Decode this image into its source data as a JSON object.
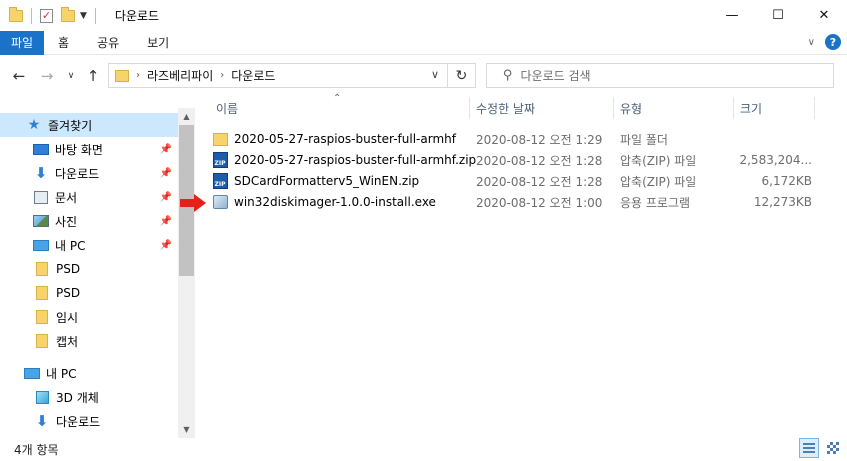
{
  "window": {
    "title": "다운로드",
    "minimize_glyph": "—",
    "maximize_glyph": "☐",
    "close_glyph": "✕"
  },
  "ribbon": {
    "tabs": [
      "파일",
      "홈",
      "공유",
      "보기"
    ],
    "help_label": "?"
  },
  "navigation": {
    "breadcrumb": [
      "라즈베리파이",
      "다운로드"
    ],
    "search_placeholder": "다운로드 검색"
  },
  "sidebar": {
    "items": [
      {
        "label": "즐겨찾기",
        "icon": "star-icon",
        "pinned": false,
        "selected": true
      },
      {
        "label": "바탕 화면",
        "icon": "desktop-icon",
        "pinned": true
      },
      {
        "label": "다운로드",
        "icon": "download-icon",
        "pinned": true
      },
      {
        "label": "문서",
        "icon": "document-icon",
        "pinned": true
      },
      {
        "label": "사진",
        "icon": "picture-icon",
        "pinned": true
      },
      {
        "label": "내 PC",
        "icon": "pc-icon",
        "pinned": true
      },
      {
        "label": "PSD",
        "icon": "folder-icon",
        "pinned": false
      },
      {
        "label": "PSD",
        "icon": "folder-icon",
        "pinned": false
      },
      {
        "label": "임시",
        "icon": "folder-icon",
        "pinned": false
      },
      {
        "label": "캡처",
        "icon": "folder-icon",
        "pinned": false
      },
      {
        "label": "내 PC",
        "icon": "pc-icon",
        "pinned": false
      },
      {
        "label": "3D 개체",
        "icon": "3d-objects-icon",
        "pinned": false
      },
      {
        "label": "다운로드",
        "icon": "download-icon",
        "pinned": false
      }
    ]
  },
  "file_list": {
    "columns": {
      "name": "이름",
      "modified": "수정한 날짜",
      "type": "유형",
      "size": "크기"
    },
    "rows": [
      {
        "name": "2020-05-27-raspios-buster-full-armhf",
        "modified": "2020-08-12 오전 1:29",
        "type": "파일 폴더",
        "size": "",
        "icon": "folder-icon"
      },
      {
        "name": "2020-05-27-raspios-buster-full-armhf.zip",
        "modified": "2020-08-12 오전 1:28",
        "type": "압축(ZIP) 파일",
        "size": "2,583,204...",
        "icon": "zip-icon"
      },
      {
        "name": "SDCardFormatterv5_WinEN.zip",
        "modified": "2020-08-12 오전 1:28",
        "type": "압축(ZIP) 파일",
        "size": "6,172KB",
        "icon": "zip-icon"
      },
      {
        "name": "win32diskimager-1.0.0-install.exe",
        "modified": "2020-08-12 오전 1:00",
        "type": "응용 프로그램",
        "size": "12,273KB",
        "icon": "installer-icon"
      }
    ]
  },
  "status": {
    "item_count": "4개 항목"
  },
  "colors": {
    "accent": "#1a73c9",
    "selection": "#cce8ff",
    "annotation_arrow": "#e8201a"
  }
}
